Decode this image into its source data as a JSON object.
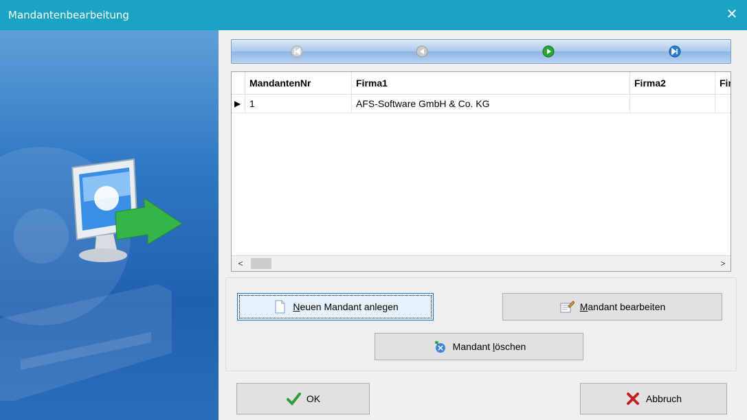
{
  "window": {
    "title": "Mandantenbearbeitung",
    "close_glyph": "✕",
    "title_color": "#1aa3c3"
  },
  "navigator": {
    "buttons": [
      {
        "name": "first-record",
        "icon": "first-record-icon",
        "enabled": false
      },
      {
        "name": "prior-record",
        "icon": "prior-record-icon",
        "enabled": false
      },
      {
        "name": "next-record",
        "icon": "next-record-icon",
        "enabled": true
      },
      {
        "name": "last-record",
        "icon": "last-record-icon",
        "enabled": true
      }
    ]
  },
  "grid": {
    "columns": [
      "MandantenNr",
      "Firma1",
      "Firma2",
      "Fir"
    ],
    "rows": [
      {
        "indicator": "▶",
        "cells": [
          "1",
          "AFS-Software GmbH & Co. KG",
          "",
          ""
        ]
      }
    ],
    "scroll_left": "<",
    "scroll_right": ">"
  },
  "actions": {
    "new_label_accel": "N",
    "new_label_rest": "euen Mandant anlegen",
    "edit_label_accel": "M",
    "edit_label_rest": "andant bearbeiten",
    "delete_label_pre": "Mandant ",
    "delete_label_accel": "l",
    "delete_label_rest": "öschen"
  },
  "footer": {
    "ok_label": "OK",
    "cancel_label": "Abbruch"
  }
}
